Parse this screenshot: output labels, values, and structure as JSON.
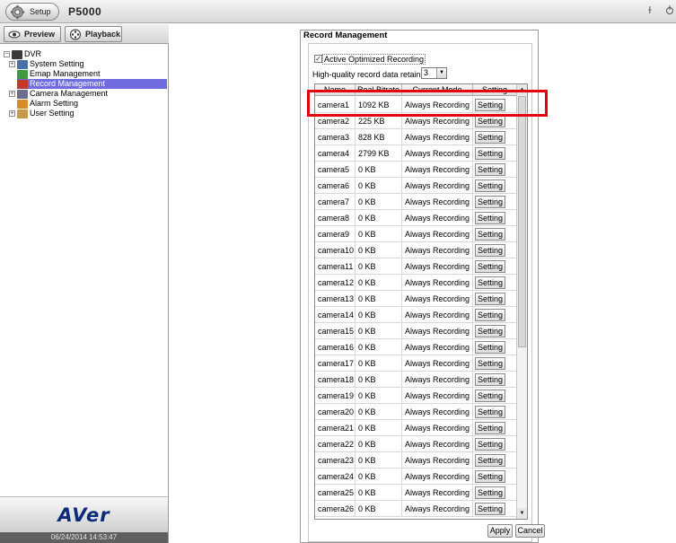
{
  "topbar": {
    "setup_label": "Setup",
    "product": "P5000"
  },
  "nav": {
    "preview_label": "Preview",
    "playback_label": "Playback"
  },
  "tree": {
    "root": "DVR",
    "items": [
      {
        "label": "System Setting",
        "expandable": true
      },
      {
        "label": "Emap Management",
        "expandable": false
      },
      {
        "label": "Record Management",
        "expandable": false,
        "selected": true
      },
      {
        "label": "Camera Management",
        "expandable": true
      },
      {
        "label": "Alarm Setting",
        "expandable": false
      },
      {
        "label": "User Setting",
        "expandable": true
      }
    ]
  },
  "brand": "AVer",
  "timestamp": "06/24/2014 14:53:47",
  "record_management": {
    "title": "Record Management",
    "active_optimized_label": "Active Optimized Recording",
    "active_optimized_checked": true,
    "retain_days_label": "High-quality record data retain days",
    "retain_days_value": "3",
    "columns": [
      "Name",
      "Real Bitrate",
      "Current Mode",
      "Setting"
    ],
    "rows": [
      {
        "name": "camera1",
        "bitrate": "1092 KB",
        "mode": "Always Recording",
        "setting": "Setting"
      },
      {
        "name": "camera2",
        "bitrate": "225 KB",
        "mode": "Always Recording",
        "setting": "Setting"
      },
      {
        "name": "camera3",
        "bitrate": "828 KB",
        "mode": "Always Recording",
        "setting": "Setting"
      },
      {
        "name": "camera4",
        "bitrate": "2799 KB",
        "mode": "Always Recording",
        "setting": "Setting"
      },
      {
        "name": "camera5",
        "bitrate": "0 KB",
        "mode": "Always Recording",
        "setting": "Setting"
      },
      {
        "name": "camera6",
        "bitrate": "0 KB",
        "mode": "Always Recording",
        "setting": "Setting"
      },
      {
        "name": "camera7",
        "bitrate": "0 KB",
        "mode": "Always Recording",
        "setting": "Setting"
      },
      {
        "name": "camera8",
        "bitrate": "0 KB",
        "mode": "Always Recording",
        "setting": "Setting"
      },
      {
        "name": "camera9",
        "bitrate": "0 KB",
        "mode": "Always Recording",
        "setting": "Setting"
      },
      {
        "name": "camera10",
        "bitrate": "0 KB",
        "mode": "Always Recording",
        "setting": "Setting"
      },
      {
        "name": "camera11",
        "bitrate": "0 KB",
        "mode": "Always Recording",
        "setting": "Setting"
      },
      {
        "name": "camera12",
        "bitrate": "0 KB",
        "mode": "Always Recording",
        "setting": "Setting"
      },
      {
        "name": "camera13",
        "bitrate": "0 KB",
        "mode": "Always Recording",
        "setting": "Setting"
      },
      {
        "name": "camera14",
        "bitrate": "0 KB",
        "mode": "Always Recording",
        "setting": "Setting"
      },
      {
        "name": "camera15",
        "bitrate": "0 KB",
        "mode": "Always Recording",
        "setting": "Setting"
      },
      {
        "name": "camera16",
        "bitrate": "0 KB",
        "mode": "Always Recording",
        "setting": "Setting"
      },
      {
        "name": "camera17",
        "bitrate": "0 KB",
        "mode": "Always Recording",
        "setting": "Setting"
      },
      {
        "name": "camera18",
        "bitrate": "0 KB",
        "mode": "Always Recording",
        "setting": "Setting"
      },
      {
        "name": "camera19",
        "bitrate": "0 KB",
        "mode": "Always Recording",
        "setting": "Setting"
      },
      {
        "name": "camera20",
        "bitrate": "0 KB",
        "mode": "Always Recording",
        "setting": "Setting"
      },
      {
        "name": "camera21",
        "bitrate": "0 KB",
        "mode": "Always Recording",
        "setting": "Setting"
      },
      {
        "name": "camera22",
        "bitrate": "0 KB",
        "mode": "Always Recording",
        "setting": "Setting"
      },
      {
        "name": "camera23",
        "bitrate": "0 KB",
        "mode": "Always Recording",
        "setting": "Setting"
      },
      {
        "name": "camera24",
        "bitrate": "0 KB",
        "mode": "Always Recording",
        "setting": "Setting"
      },
      {
        "name": "camera25",
        "bitrate": "0 KB",
        "mode": "Always Recording",
        "setting": "Setting"
      },
      {
        "name": "camera26",
        "bitrate": "0 KB",
        "mode": "Always Recording",
        "setting": "Setting"
      }
    ],
    "apply_label": "Apply",
    "cancel_label": "Cancel"
  },
  "colors": {
    "selection": "#6f6ce0",
    "highlight": "#e3000f",
    "brand": "#0b2a7a"
  },
  "icons": [
    "gear-icon",
    "eye-icon",
    "film-reel-icon",
    "dvr-icon",
    "system-icon",
    "emap-icon",
    "record-icon",
    "camera-icon",
    "alarm-icon",
    "user-icon",
    "minimize-icon",
    "power-icon"
  ]
}
